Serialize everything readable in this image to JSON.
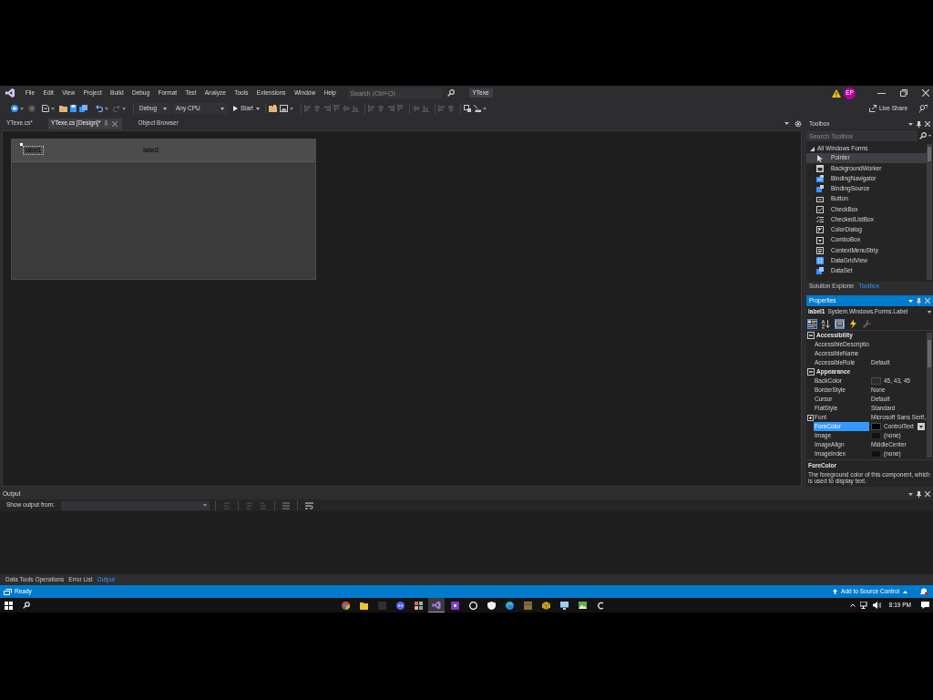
{
  "title_bar": {
    "menu": [
      "File",
      "Edit",
      "View",
      "Project",
      "Build",
      "Debug",
      "Format",
      "Test",
      "Analyze",
      "Tools",
      "Extensions",
      "Window",
      "Help"
    ],
    "search": {
      "placeholder": "Search (Ctrl+Q)"
    },
    "solution": "YTexe",
    "account": "EP"
  },
  "toolbar": {
    "configuration": "Debug",
    "platform": "Any CPU",
    "start": "Start",
    "live_share": "Live Share"
  },
  "document_tabs": [
    {
      "label": "YTexe.cs*",
      "selected": false
    },
    {
      "label": "YTexe.cs [Design]*",
      "selected": true
    },
    {
      "label": "Object Browser",
      "selected": false
    }
  ],
  "designer": {
    "labels": [
      {
        "text": "label1",
        "selected": true
      },
      {
        "text": "label2",
        "selected": false
      }
    ]
  },
  "toolbox": {
    "title": "Toolbox",
    "search": {
      "placeholder": "Search Toolbox"
    },
    "group": {
      "label": "All Windows Forms",
      "expanded": true,
      "items": [
        {
          "label": "Pointer",
          "selected": true
        },
        {
          "label": "BackgroundWorker",
          "selected": false
        },
        {
          "label": "BindingNavigator",
          "selected": false
        },
        {
          "label": "BindingSource",
          "selected": false
        },
        {
          "label": "Button",
          "selected": false
        },
        {
          "label": "CheckBox",
          "selected": false
        },
        {
          "label": "CheckedListBox",
          "selected": false
        },
        {
          "label": "ColorDialog",
          "selected": false
        },
        {
          "label": "ComboBox",
          "selected": false
        },
        {
          "label": "ContextMenuStrip",
          "selected": false
        },
        {
          "label": "DataGridView",
          "selected": false
        },
        {
          "label": "DataSet",
          "selected": false
        }
      ]
    },
    "tabs": [
      {
        "label": "Solution Explorer",
        "selected": false
      },
      {
        "label": "Toolbox",
        "selected": true
      }
    ]
  },
  "properties": {
    "title": "Properties",
    "object": "label1",
    "object_type": "System.Windows.Forms.Label",
    "tool_buttons": [
      {
        "selected": true,
        "disabled": false
      },
      {
        "selected": false,
        "disabled": false
      },
      {
        "selected": true,
        "disabled": false
      },
      {
        "selected": false,
        "disabled": false
      },
      {
        "selected": false,
        "disabled": true
      }
    ],
    "categories": [
      {
        "name": "Accessibility",
        "expanded": true,
        "rows": [
          {
            "name": "AccessibleDescriptio",
            "kind": "text",
            "selected": false
          },
          {
            "name": "AccessibleName",
            "kind": "text",
            "selected": false
          },
          {
            "name": "AccessibleRole",
            "kind": "text",
            "value": "Default",
            "selected": false
          }
        ]
      },
      {
        "name": "Appearance",
        "expanded": true,
        "rows": [
          {
            "name": "BackColor",
            "kind": "color",
            "color": "#2d2b2d",
            "value": "45, 43, 45",
            "selected": false
          },
          {
            "name": "BorderStyle",
            "kind": "text",
            "value": "None",
            "selected": false
          },
          {
            "name": "Cursor",
            "kind": "text",
            "value": "Default",
            "selected": false
          },
          {
            "name": "FlatStyle",
            "kind": "text",
            "value": "Standard",
            "selected": false
          },
          {
            "name": "Font",
            "kind": "expandable",
            "value": "Microsoft Sans Serif,",
            "selected": false
          },
          {
            "name": "ForeColor",
            "kind": "color",
            "color": "#000000",
            "value": "ControlText",
            "selected": true
          },
          {
            "name": "Image",
            "kind": "image",
            "value": "(none)",
            "selected": false
          },
          {
            "name": "ImageAlign",
            "kind": "text",
            "value": "MiddleCenter",
            "selected": false
          },
          {
            "name": "ImageIndex",
            "kind": "image",
            "value": "(none)",
            "selected": false
          }
        ]
      }
    ],
    "description": {
      "title": "ForeColor",
      "text": "The foreground color of this component, which is used to display text."
    }
  },
  "output": {
    "title": "Output",
    "source_label": "Show output from:",
    "tabs": [
      {
        "label": "Data Tools Operations",
        "selected": false
      },
      {
        "label": "Error List",
        "selected": false
      },
      {
        "label": "Output",
        "selected": true
      }
    ]
  },
  "status_bar": {
    "text": "Ready",
    "source_control": "Add to Source Control"
  },
  "taskbar": {
    "apps": [
      {
        "selected": false
      },
      {
        "selected": false
      },
      {
        "selected": false
      },
      {
        "selected": false
      },
      {
        "selected": false
      },
      {
        "selected": true
      },
      {
        "selected": false
      },
      {
        "selected": false
      },
      {
        "selected": false
      },
      {
        "selected": false
      },
      {
        "selected": false
      },
      {
        "selected": false
      },
      {
        "selected": false
      },
      {
        "selected": false
      },
      {
        "selected": false
      }
    ],
    "clock": "8:19 PM"
  }
}
